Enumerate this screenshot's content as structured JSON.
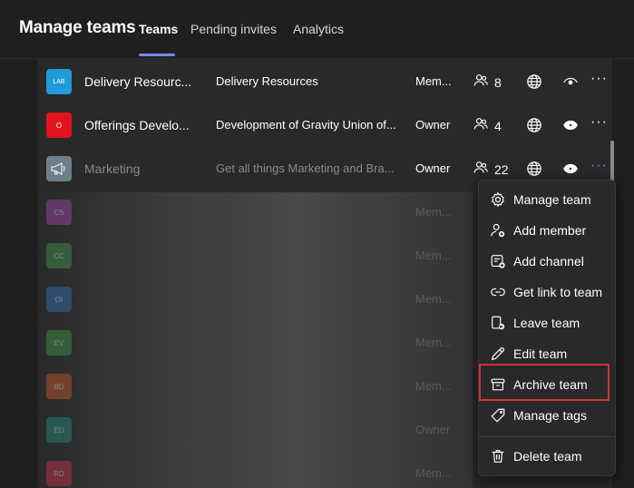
{
  "header": {
    "title": "Manage teams",
    "tabs": [
      {
        "label": "Teams",
        "active": true
      },
      {
        "label": "Pending invites",
        "active": false
      },
      {
        "label": "Analytics",
        "active": false
      }
    ]
  },
  "teams": [
    {
      "avatar": "LAB",
      "avatar_color": "#1e9bd8",
      "name": "Delivery Resourc...",
      "description": "Delivery Resources",
      "role": "Mem...",
      "members": "8"
    },
    {
      "avatar": "O",
      "avatar_color": "#e3131e",
      "name": "Offerings Develo...",
      "description": "Development of Gravity Union of...",
      "role": "Owner",
      "members": "4"
    },
    {
      "avatar": "megaphone",
      "avatar_color": "#6d7f8a",
      "name": "Marketing",
      "description": "Get all things Marketing and Bra...",
      "role": "Owner",
      "members": "22"
    },
    {
      "avatar": "CS",
      "avatar_color": "#b146c2",
      "name": "",
      "description": "",
      "role": "Mem..."
    },
    {
      "avatar": "CC",
      "avatar_color": "#3fa34d",
      "name": "",
      "description": "",
      "role": "Mem..."
    },
    {
      "avatar": "OI",
      "avatar_color": "#2f78c8",
      "name": "",
      "description": "",
      "role": "Mem..."
    },
    {
      "avatar": "EV",
      "avatar_color": "#3fa34d",
      "name": "",
      "description": "",
      "role": "Mem..."
    },
    {
      "avatar": "BD",
      "avatar_color": "#d85c28",
      "name": "",
      "description": "",
      "role": "Mem..."
    },
    {
      "avatar": "ED",
      "avatar_color": "#1a9a8a",
      "name": "",
      "description": "",
      "role": "Owner"
    },
    {
      "avatar": "RD",
      "avatar_color": "#d8344a",
      "name": "",
      "description": "",
      "role": "Mem..."
    }
  ],
  "context_menu": {
    "items": [
      {
        "label": "Manage team",
        "icon": "gear-icon"
      },
      {
        "label": "Add member",
        "icon": "add-member-icon"
      },
      {
        "label": "Add channel",
        "icon": "add-channel-icon"
      },
      {
        "label": "Get link to team",
        "icon": "link-icon"
      },
      {
        "label": "Leave team",
        "icon": "leave-icon"
      },
      {
        "label": "Edit team",
        "icon": "pencil-icon"
      },
      {
        "label": "Archive team",
        "icon": "archive-icon"
      },
      {
        "label": "Manage tags",
        "icon": "tag-icon"
      },
      {
        "label": "Delete team",
        "icon": "trash-icon"
      }
    ],
    "highlighted": "Archive team"
  },
  "colors": {
    "accent": "#7f85f5",
    "highlight_border": "#d13438"
  }
}
